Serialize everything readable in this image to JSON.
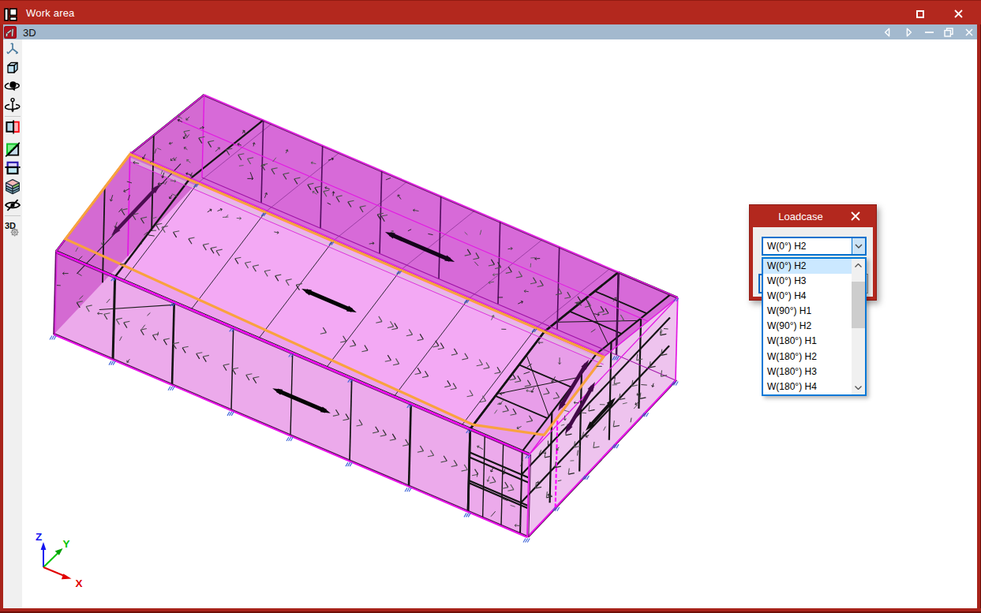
{
  "window": {
    "title": "Work area",
    "controls": {
      "maximize": "maximize",
      "close": "close"
    }
  },
  "tab_bar": {
    "tab": {
      "label": "3D"
    },
    "controls": [
      "previous",
      "next",
      "minimize",
      "restore",
      "close"
    ]
  },
  "toolbar": {
    "items": [
      {
        "icon": "axes-tripod-icon"
      },
      {
        "icon": "cube-3d-icon"
      },
      {
        "icon": "orbit-view-icon"
      },
      {
        "icon": "spin-view-icon"
      },
      {
        "icon": "clip-section-icon"
      },
      {
        "icon": "render-mode-icon"
      },
      {
        "icon": "workplane-icon"
      },
      {
        "icon": "layers-icon"
      },
      {
        "icon": "hide-objects-icon"
      },
      {
        "icon": "settings-3d-icon",
        "label": "3D"
      }
    ]
  },
  "canvas": {
    "axis_triad": {
      "x_label": "X",
      "y_label": "Y",
      "z_label": "Z",
      "x_color": "#e10000",
      "y_color": "#00c400",
      "z_color": "#1414f0"
    }
  },
  "dialog": {
    "title": "Loadcase",
    "combo": {
      "value": "W(0°) H2"
    },
    "dropdown": {
      "items": [
        "W(0°) H2",
        "W(0°) H3",
        "W(0°) H4",
        "W(90°) H1",
        "W(90°) H2",
        "W(180°) H1",
        "W(180°) H2",
        "W(180°) H3",
        "W(180°) H4"
      ],
      "selected_index": 0
    }
  },
  "colors": {
    "titlebar_red": "#b3281e",
    "tabbar_blue": "#a3b9ce",
    "accent_blue": "#0078d7",
    "selection_blue": "#cbe8ff",
    "selection_orange": "#f9a23e",
    "model_magenta": "#e318e3"
  }
}
